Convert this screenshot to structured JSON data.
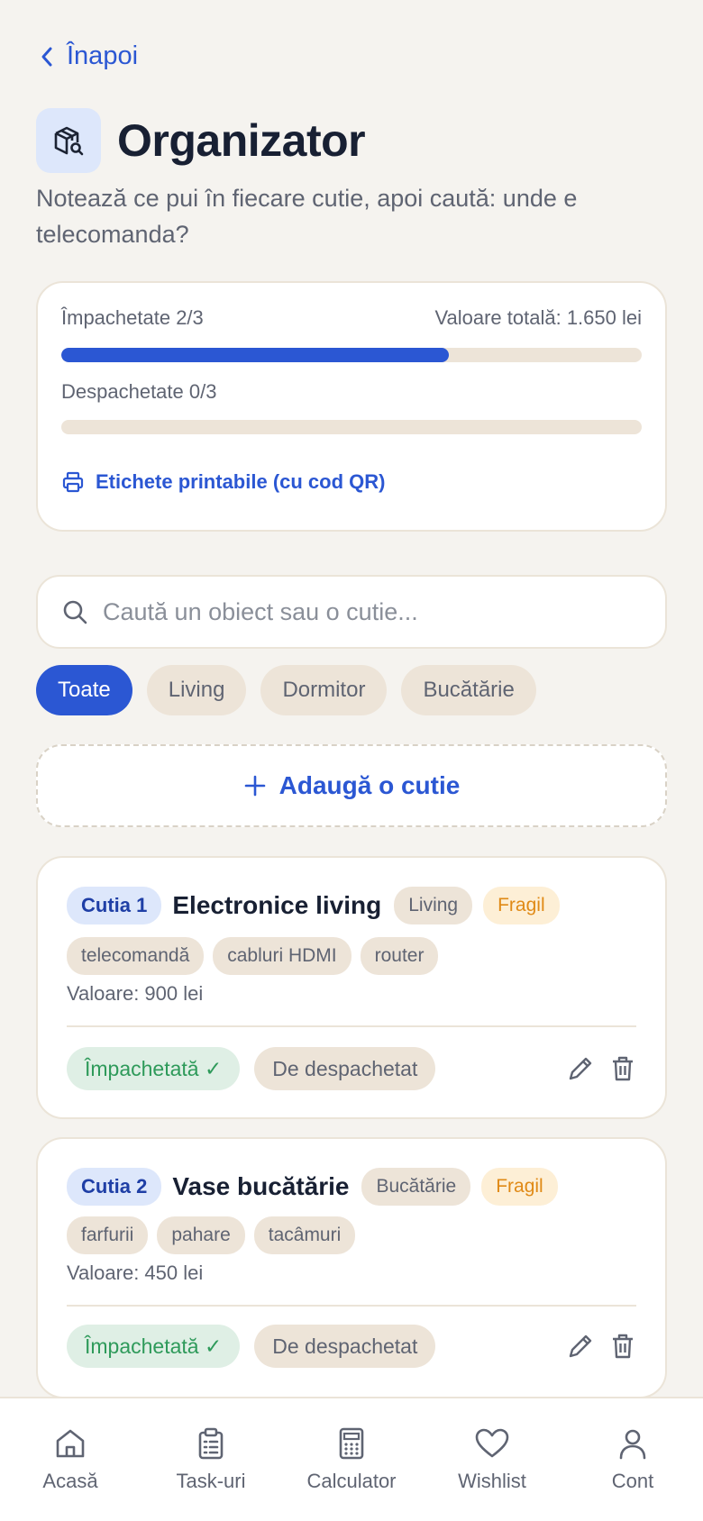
{
  "back": {
    "label": "Înapoi"
  },
  "header": {
    "title": "Organizator",
    "subtitle": "Notează ce pui în fiecare cutie, apoi caută: unde e telecomanda?"
  },
  "stats": {
    "packed_label": "Împachetate 2/3",
    "packed_progress": 0.667,
    "total_value_label": "Valoare totală: 1.650 lei",
    "unpacked_label": "Despachetate 0/3",
    "unpacked_progress": 0,
    "print_link": "Etichete printabile (cu cod QR)"
  },
  "search": {
    "placeholder": "Caută un obiect sau o cutie..."
  },
  "filters": [
    "Toate",
    "Living",
    "Dormitor",
    "Bucătărie"
  ],
  "add_box": {
    "label": "Adaugă o cutie"
  },
  "boxes": [
    {
      "id": "Cutia 1",
      "name": "Electronice living",
      "room": "Living",
      "fragile": "Fragil",
      "items": [
        "telecomandă",
        "cabluri HDMI",
        "router"
      ],
      "value": "Valoare: 900 lei",
      "packed_status": "Împachetată ✓",
      "unpack_status": "De despachetat"
    },
    {
      "id": "Cutia 2",
      "name": "Vase bucătărie",
      "room": "Bucătărie",
      "fragile": "Fragil",
      "items": [
        "farfurii",
        "pahare",
        "tacâmuri"
      ],
      "value": "Valoare: 450 lei",
      "packed_status": "Împachetată ✓",
      "unpack_status": "De despachetat"
    }
  ],
  "nav": {
    "home": "Acasă",
    "tasks": "Task-uri",
    "calculator": "Calculator",
    "wishlist": "Wishlist",
    "account": "Cont"
  },
  "colors": {
    "accent": "#2b57d3",
    "background": "#f5f3ef",
    "packed_green": "#2e9a5a",
    "fragile_orange": "#e08a16"
  }
}
